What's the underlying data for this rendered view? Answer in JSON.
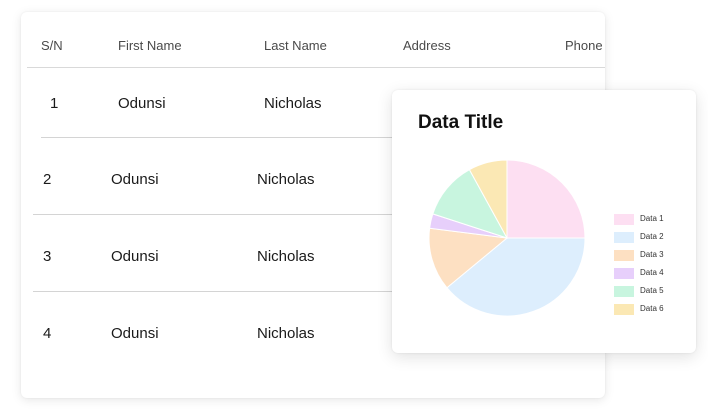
{
  "table": {
    "columns": [
      "S/N",
      "First Name",
      "Last Name",
      "Address",
      "Phone"
    ],
    "rows": [
      {
        "sn": "1",
        "first_name": "Odunsi",
        "last_name": "Nicholas"
      },
      {
        "sn": "2",
        "first_name": "Odunsi",
        "last_name": "Nicholas"
      },
      {
        "sn": "3",
        "first_name": "Odunsi",
        "last_name": "Nicholas"
      },
      {
        "sn": "4",
        "first_name": "Odunsi",
        "last_name": "Nicholas"
      }
    ]
  },
  "chart_card": {
    "title": "Data Title"
  },
  "chart_data": {
    "type": "pie",
    "title": "Data Title",
    "legend": "right",
    "categories": [
      "Data 1",
      "Data 2",
      "Data 3",
      "Data 4",
      "Data 5",
      "Data 6"
    ],
    "values": [
      25,
      39,
      13,
      3,
      12,
      8
    ],
    "colors": [
      "#fddff2",
      "#ddeefd",
      "#fde0c2",
      "#e7cffb",
      "#c8f5df",
      "#fbe8b4"
    ]
  }
}
